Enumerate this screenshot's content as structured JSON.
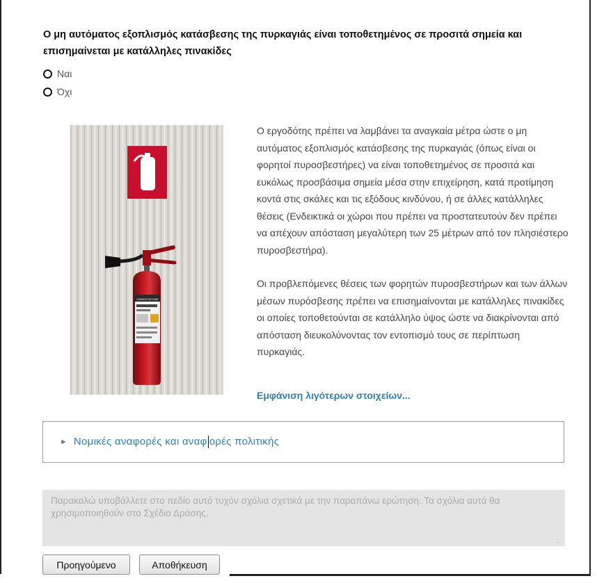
{
  "question": {
    "text": "Ο μη αυτόματος εξοπλισμός κατάσβεσης της πυρκαγιάς είναι τοποθετημένος σε προσιτά σημεία και επισημαίνεται με κατάλληλες πινακίδες"
  },
  "options": [
    {
      "label": "Ναι",
      "selected": false
    },
    {
      "label": "Όχι",
      "selected": false
    }
  ],
  "image": {
    "subject": "fire-extinguisher-photo",
    "cylinder_text": "CARBON DIOXIDE"
  },
  "description": {
    "paragraph1": "Ο εργοδότης πρέπει να λαμβάνει τα αναγκαία μέτρα ώστε ο μη αυτόματος εξοπλισμός κατάσβεσης της πυρκαγιάς (όπως είναι οι φορητοί πυροσβεστήρες) να είναι τοποθετημένος σε προσιτά και ευκόλως προσβάσιμα σημεία μέσα στην επιχείρηση, κατά προτίμηση κοντά στις σκάλες και τις εξόδους κινδύνου, ή σε άλλες κατάλληλες θέσεις (Ενδεικτικά οι χώροι που πρέπει να προστατευτούν δεν πρέπει να απέχουν απόσταση μεγαλύτερη των 25 μέτρων από τον πλησιέστερο πυροσβεστήρα).",
    "paragraph2": "Οι προβλεπόμενες θέσεις των φορητών πυροσβεστήρων και των άλλων μέσων πυρόσβεσης πρέπει να επισημαίνονται με κατάλληλες πινακίδες οι οποίες τοποθετούνται σε κατάλληλο ύψος ώστε να διακρίνονται από απόσταση διευκολύνοντας τον εντοπισμό τους σε περίπτωση πυρκαγιάς.",
    "toggle_label": "Εμφάνιση λιγότερων στοιχείων..."
  },
  "legal": {
    "label_before_caret": "Νομικές αναφορές και αναφ",
    "label_after_caret": "ορές πολιτικής",
    "expanded": false
  },
  "comment": {
    "placeholder": "Παρακαλώ υποβάλλετε στο πεδίο αυτό τυχόν σχόλια σχετικά με την παραπάνω ερώτηση. Τα σχόλια αυτά θα χρησιμοποιηθούν στο Σχέδιο Δράσης.",
    "value": ""
  },
  "buttons": {
    "previous": "Προηγούμενο",
    "save": "Αποθήκευση"
  },
  "colors": {
    "link": "#2f7fb5",
    "textarea_bg": "#e4e4e4",
    "sign_red": "#c8102e",
    "extinguisher_red": "#b3121b"
  }
}
